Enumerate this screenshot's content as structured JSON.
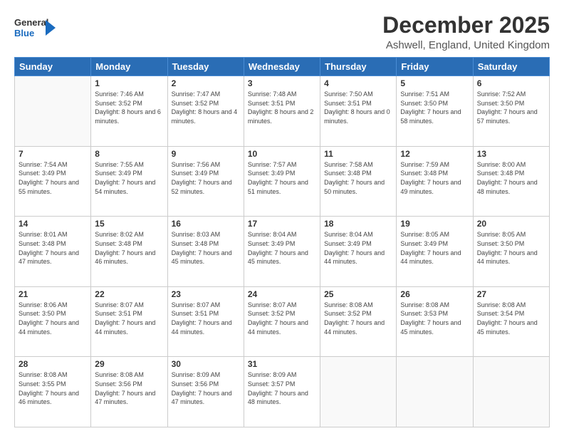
{
  "logo": {
    "line1": "General",
    "line2": "Blue"
  },
  "title": "December 2025",
  "location": "Ashwell, England, United Kingdom",
  "days_header": [
    "Sunday",
    "Monday",
    "Tuesday",
    "Wednesday",
    "Thursday",
    "Friday",
    "Saturday"
  ],
  "weeks": [
    [
      {
        "day": "",
        "sunrise": "",
        "sunset": "",
        "daylight": ""
      },
      {
        "day": "1",
        "sunrise": "Sunrise: 7:46 AM",
        "sunset": "Sunset: 3:52 PM",
        "daylight": "Daylight: 8 hours and 6 minutes."
      },
      {
        "day": "2",
        "sunrise": "Sunrise: 7:47 AM",
        "sunset": "Sunset: 3:52 PM",
        "daylight": "Daylight: 8 hours and 4 minutes."
      },
      {
        "day": "3",
        "sunrise": "Sunrise: 7:48 AM",
        "sunset": "Sunset: 3:51 PM",
        "daylight": "Daylight: 8 hours and 2 minutes."
      },
      {
        "day": "4",
        "sunrise": "Sunrise: 7:50 AM",
        "sunset": "Sunset: 3:51 PM",
        "daylight": "Daylight: 8 hours and 0 minutes."
      },
      {
        "day": "5",
        "sunrise": "Sunrise: 7:51 AM",
        "sunset": "Sunset: 3:50 PM",
        "daylight": "Daylight: 7 hours and 58 minutes."
      },
      {
        "day": "6",
        "sunrise": "Sunrise: 7:52 AM",
        "sunset": "Sunset: 3:50 PM",
        "daylight": "Daylight: 7 hours and 57 minutes."
      }
    ],
    [
      {
        "day": "7",
        "sunrise": "Sunrise: 7:54 AM",
        "sunset": "Sunset: 3:49 PM",
        "daylight": "Daylight: 7 hours and 55 minutes."
      },
      {
        "day": "8",
        "sunrise": "Sunrise: 7:55 AM",
        "sunset": "Sunset: 3:49 PM",
        "daylight": "Daylight: 7 hours and 54 minutes."
      },
      {
        "day": "9",
        "sunrise": "Sunrise: 7:56 AM",
        "sunset": "Sunset: 3:49 PM",
        "daylight": "Daylight: 7 hours and 52 minutes."
      },
      {
        "day": "10",
        "sunrise": "Sunrise: 7:57 AM",
        "sunset": "Sunset: 3:49 PM",
        "daylight": "Daylight: 7 hours and 51 minutes."
      },
      {
        "day": "11",
        "sunrise": "Sunrise: 7:58 AM",
        "sunset": "Sunset: 3:48 PM",
        "daylight": "Daylight: 7 hours and 50 minutes."
      },
      {
        "day": "12",
        "sunrise": "Sunrise: 7:59 AM",
        "sunset": "Sunset: 3:48 PM",
        "daylight": "Daylight: 7 hours and 49 minutes."
      },
      {
        "day": "13",
        "sunrise": "Sunrise: 8:00 AM",
        "sunset": "Sunset: 3:48 PM",
        "daylight": "Daylight: 7 hours and 48 minutes."
      }
    ],
    [
      {
        "day": "14",
        "sunrise": "Sunrise: 8:01 AM",
        "sunset": "Sunset: 3:48 PM",
        "daylight": "Daylight: 7 hours and 47 minutes."
      },
      {
        "day": "15",
        "sunrise": "Sunrise: 8:02 AM",
        "sunset": "Sunset: 3:48 PM",
        "daylight": "Daylight: 7 hours and 46 minutes."
      },
      {
        "day": "16",
        "sunrise": "Sunrise: 8:03 AM",
        "sunset": "Sunset: 3:48 PM",
        "daylight": "Daylight: 7 hours and 45 minutes."
      },
      {
        "day": "17",
        "sunrise": "Sunrise: 8:04 AM",
        "sunset": "Sunset: 3:49 PM",
        "daylight": "Daylight: 7 hours and 45 minutes."
      },
      {
        "day": "18",
        "sunrise": "Sunrise: 8:04 AM",
        "sunset": "Sunset: 3:49 PM",
        "daylight": "Daylight: 7 hours and 44 minutes."
      },
      {
        "day": "19",
        "sunrise": "Sunrise: 8:05 AM",
        "sunset": "Sunset: 3:49 PM",
        "daylight": "Daylight: 7 hours and 44 minutes."
      },
      {
        "day": "20",
        "sunrise": "Sunrise: 8:05 AM",
        "sunset": "Sunset: 3:50 PM",
        "daylight": "Daylight: 7 hours and 44 minutes."
      }
    ],
    [
      {
        "day": "21",
        "sunrise": "Sunrise: 8:06 AM",
        "sunset": "Sunset: 3:50 PM",
        "daylight": "Daylight: 7 hours and 44 minutes."
      },
      {
        "day": "22",
        "sunrise": "Sunrise: 8:07 AM",
        "sunset": "Sunset: 3:51 PM",
        "daylight": "Daylight: 7 hours and 44 minutes."
      },
      {
        "day": "23",
        "sunrise": "Sunrise: 8:07 AM",
        "sunset": "Sunset: 3:51 PM",
        "daylight": "Daylight: 7 hours and 44 minutes."
      },
      {
        "day": "24",
        "sunrise": "Sunrise: 8:07 AM",
        "sunset": "Sunset: 3:52 PM",
        "daylight": "Daylight: 7 hours and 44 minutes."
      },
      {
        "day": "25",
        "sunrise": "Sunrise: 8:08 AM",
        "sunset": "Sunset: 3:52 PM",
        "daylight": "Daylight: 7 hours and 44 minutes."
      },
      {
        "day": "26",
        "sunrise": "Sunrise: 8:08 AM",
        "sunset": "Sunset: 3:53 PM",
        "daylight": "Daylight: 7 hours and 45 minutes."
      },
      {
        "day": "27",
        "sunrise": "Sunrise: 8:08 AM",
        "sunset": "Sunset: 3:54 PM",
        "daylight": "Daylight: 7 hours and 45 minutes."
      }
    ],
    [
      {
        "day": "28",
        "sunrise": "Sunrise: 8:08 AM",
        "sunset": "Sunset: 3:55 PM",
        "daylight": "Daylight: 7 hours and 46 minutes."
      },
      {
        "day": "29",
        "sunrise": "Sunrise: 8:08 AM",
        "sunset": "Sunset: 3:56 PM",
        "daylight": "Daylight: 7 hours and 47 minutes."
      },
      {
        "day": "30",
        "sunrise": "Sunrise: 8:09 AM",
        "sunset": "Sunset: 3:56 PM",
        "daylight": "Daylight: 7 hours and 47 minutes."
      },
      {
        "day": "31",
        "sunrise": "Sunrise: 8:09 AM",
        "sunset": "Sunset: 3:57 PM",
        "daylight": "Daylight: 7 hours and 48 minutes."
      },
      {
        "day": "",
        "sunrise": "",
        "sunset": "",
        "daylight": ""
      },
      {
        "day": "",
        "sunrise": "",
        "sunset": "",
        "daylight": ""
      },
      {
        "day": "",
        "sunrise": "",
        "sunset": "",
        "daylight": ""
      }
    ]
  ]
}
